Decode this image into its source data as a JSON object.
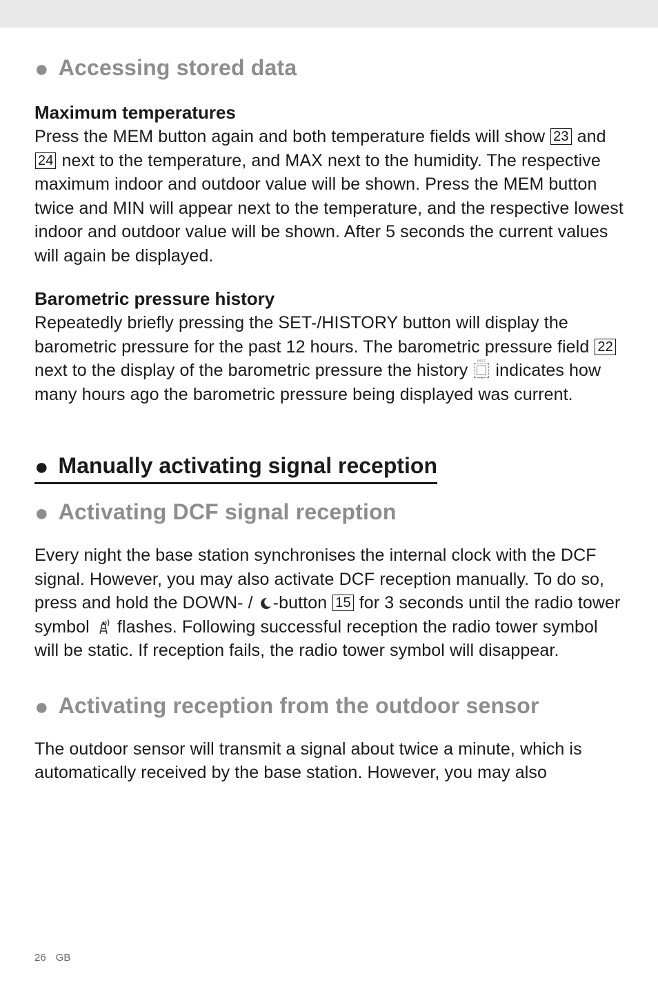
{
  "sections": {
    "accessing": {
      "title": "Accessing stored data"
    },
    "maxtemp": {
      "title": "Maximum temperatures",
      "line1a": "Press the MEM button again and both temperature fields will show ",
      "ref23": "23",
      "line1b": " and ",
      "ref24": "24",
      "line1c": " next to the temperature, and MAX next to the humidity. The respective maximum indoor and outdoor value will be shown. Press the MEM button twice and MIN will appear next to the temperature, and the respective lowest indoor and outdoor value will be shown. After 5 seconds the current values will again be displayed."
    },
    "baro": {
      "title": "Barometric pressure history",
      "line1a": "Repeatedly briefly pressing the SET-/HISTORY button will display the barometric pressure for the past 12 hours. The barometric pressure field ",
      "ref22": "22",
      "line1b": " next to the display of the barometric pressure the history ",
      "iconTop": "HIST",
      "iconBot": "HR",
      "line1c": " indicates how many hours ago the barometric pressure being displayed was current."
    },
    "manual": {
      "title": "Manually activating signal reception"
    },
    "dcf": {
      "title": "Activating DCF signal reception",
      "line1a": "Every night the base station synchronises the internal clock with the DCF signal. However, you may also activate DCF reception manually. To do so, press and hold the DOWN- / ",
      "line1b": "-button ",
      "ref15": "15",
      "line1c": " for 3 seconds until the radio tower symbol ",
      "line1d": " flashes. Following successful reception the radio tower symbol will be static. If reception fails, the radio tower symbol will disappear."
    },
    "outdoor": {
      "title": "Activating reception from the outdoor sensor",
      "body": "The outdoor sensor will transmit a signal about twice a minute, which is automatically received by the base station. However, you may also"
    }
  },
  "footer": {
    "page": "26",
    "region": "GB"
  }
}
